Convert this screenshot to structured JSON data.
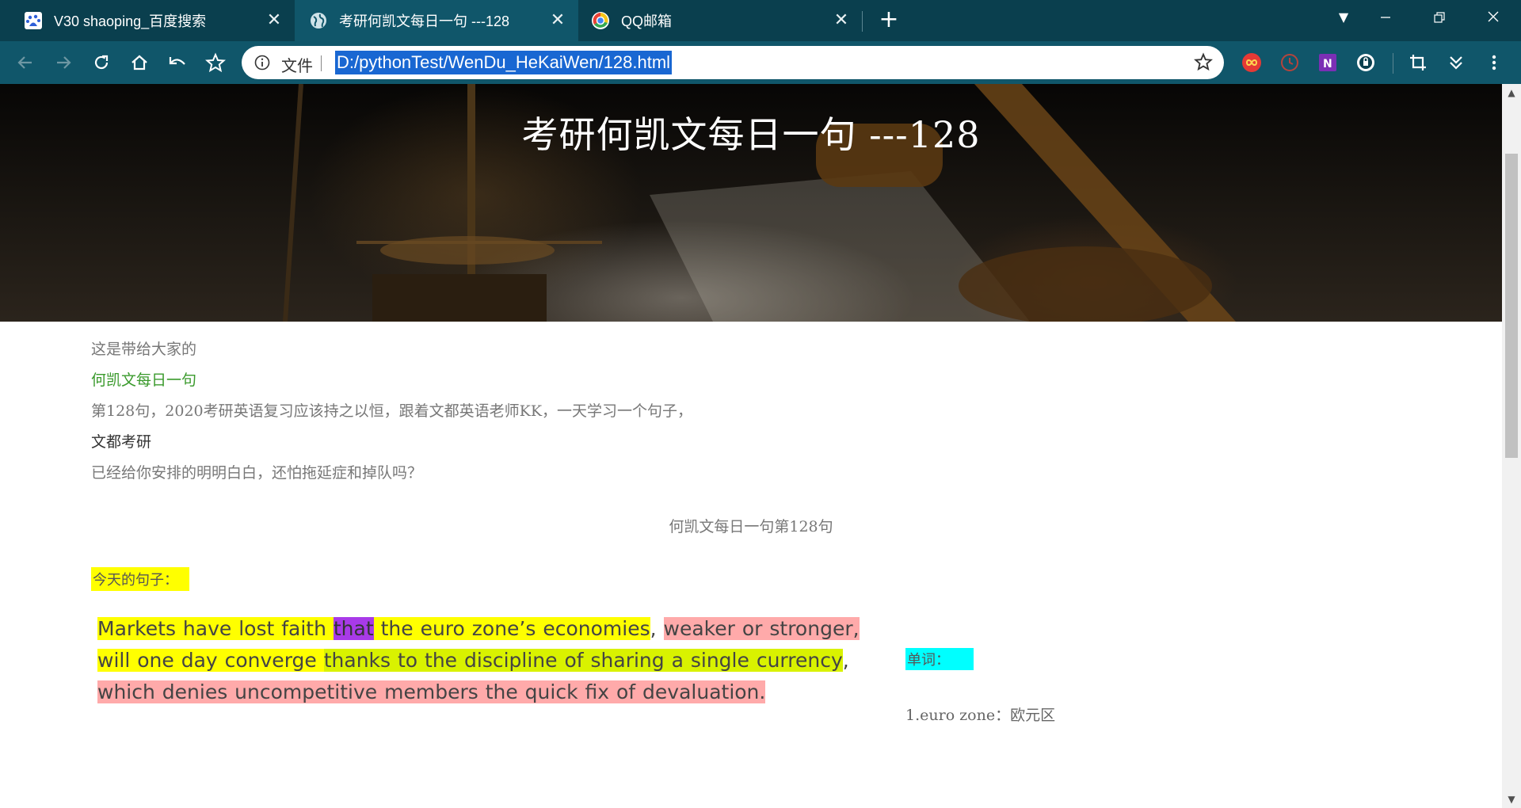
{
  "tabs": [
    {
      "title": "V30 shaoping_百度搜索",
      "icon": "baidu-icon"
    },
    {
      "title": "考研何凯文每日一句 ---128",
      "icon": "globe-icon"
    },
    {
      "title": "QQ邮箱",
      "icon": "qqmail-icon"
    }
  ],
  "toolbar": {
    "scheme_label": "文件",
    "url": "D:/pythonTest/WenDu_HeKaiWen/128.html"
  },
  "page": {
    "hero_title": "考研何凯文每日一句 ---128",
    "intro": [
      "这是带给大家的",
      "何凯文每日一句",
      "第128句，2020考研英语复习应该持之以恒，跟着文都英语老师KK，一天学习一个句子，",
      "文都考研",
      "已经给你安排的明明白白，还怕拖延症和掉队吗？"
    ],
    "caption": "何凯文每日一句第128句",
    "today_label": "今天的句子：",
    "sentence": {
      "s1": "Markets have lost faith ",
      "s2": "that",
      "s3": " the euro zone’s economies",
      "s4": ", ",
      "s5": "weaker or stronger,",
      "s6": " ",
      "s7": "will one day converge ",
      "s8": "thanks to the discipline of sharing a single currency",
      "s9": ", ",
      "s10": "which denies uncompetitive members the quick fix of devaluation."
    },
    "vocab_title": "单词：",
    "vocab_first": "1.euro zone：欧元区"
  },
  "colors": {
    "tabstrip": "#0a3f4e",
    "toolbar": "#10566a",
    "highlight_yellow": "#ffff00",
    "highlight_purple": "#a83ae8",
    "highlight_green": "#d9f200",
    "highlight_pink": "#ffaaaa",
    "highlight_cyan": "#00ffff",
    "title_green": "#3a9a2c"
  }
}
